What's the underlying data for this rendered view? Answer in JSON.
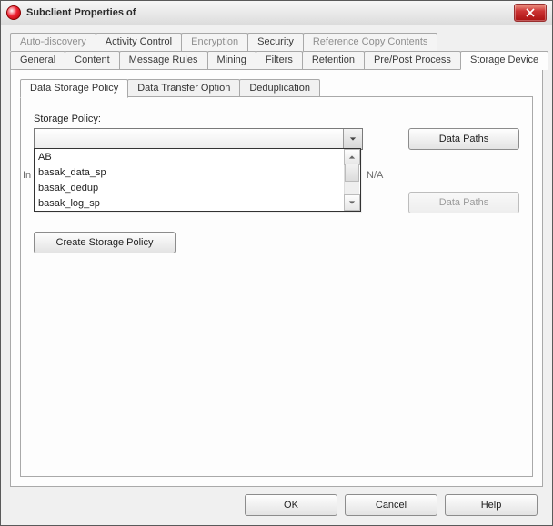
{
  "titlebar": {
    "title": "Subclient Properties of"
  },
  "tabs_row1": {
    "auto_discovery": "Auto-discovery",
    "activity_control": "Activity Control",
    "encryption": "Encryption",
    "security": "Security",
    "reference_copy": "Reference Copy Contents"
  },
  "tabs_row2": {
    "general": "General",
    "content": "Content",
    "message_rules": "Message Rules",
    "mining": "Mining",
    "filters": "Filters",
    "retention": "Retention",
    "prepost": "Pre/Post Process",
    "storage_device": "Storage Device"
  },
  "subtabs": {
    "data_storage_policy": "Data Storage Policy",
    "data_transfer_option": "Data Transfer Option",
    "deduplication": "Deduplication"
  },
  "content": {
    "storage_policy_label": "Storage Policy:",
    "dropdown_options": [
      "AB",
      "basak_data_sp",
      "basak_dedup",
      "basak_log_sp"
    ],
    "inc_hint_prefix": "In",
    "na_value": "N/A",
    "data_paths_label": "Data Paths",
    "data_paths_label2": "Data Paths",
    "create_sp_label": "Create Storage Policy"
  },
  "footer": {
    "ok": "OK",
    "cancel": "Cancel",
    "help": "Help"
  }
}
